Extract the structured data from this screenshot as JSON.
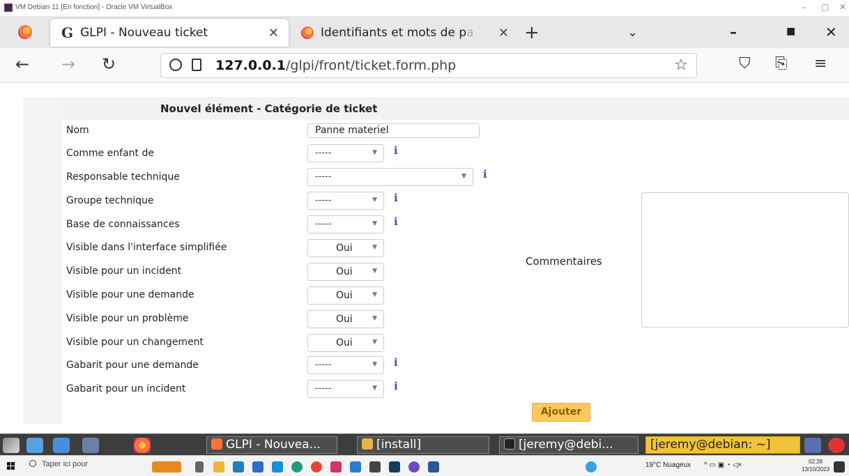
{
  "vbox": {
    "title": "VM Debian 11 [En fonction] - Oracle VM VirtualBox",
    "min": "–",
    "max": "▢",
    "close": "✕"
  },
  "browser": {
    "tabs": [
      {
        "label": "GLPI - Nouveau ticket",
        "icon": "glpi-icon",
        "active": true
      },
      {
        "label": "Identifiants et mots de p",
        "fade": "a",
        "icon": "firefox-icon",
        "active": false
      }
    ],
    "close_glyph": "✕",
    "newtab_glyph": "+",
    "dropdown_glyph": "⌄",
    "url_host": "127.0.0.1",
    "url_path": "/glpi/front/ticket.form.php"
  },
  "form": {
    "header": "Nouvel élément - Catégorie de ticket",
    "name_label": "Nom",
    "name_value": "Panne materiel",
    "fields": [
      {
        "label": "Comme enfant de",
        "value": "-----",
        "info": true
      },
      {
        "label": "Responsable technique",
        "value": "-----",
        "info": true
      },
      {
        "label": "Groupe technique",
        "value": "-----",
        "info": true
      },
      {
        "label": "Base de connaissances",
        "value": "-----",
        "info": true
      },
      {
        "label": "Visible dans l'interface simplifiée",
        "value": "Oui"
      },
      {
        "label": "Visible pour un incident",
        "value": "Oui"
      },
      {
        "label": "Visible pour une demande",
        "value": "Oui"
      },
      {
        "label": "Visible pour un problème",
        "value": "Oui"
      },
      {
        "label": "Visible pour un changement",
        "value": "Oui"
      },
      {
        "label": "Gabarit pour une demande",
        "value": "-----",
        "info": true
      },
      {
        "label": "Gabarit pour un incident",
        "value": "-----",
        "info": true
      }
    ],
    "comment_label": "Commentaires",
    "submit_label": "Ajouter",
    "info_glyph": "i",
    "arrow_glyph": "▼"
  },
  "xfce_panel": {
    "tasks": [
      "GLPI - Nouvea...",
      "[install]",
      "[jeremy@debi...",
      "[jeremy@debian: ~]"
    ]
  },
  "windows_taskbar": {
    "search_placeholder": "Taper ici pour",
    "weather": "19°C Nuageux",
    "time": "02:28",
    "date": "13/10/2023"
  }
}
